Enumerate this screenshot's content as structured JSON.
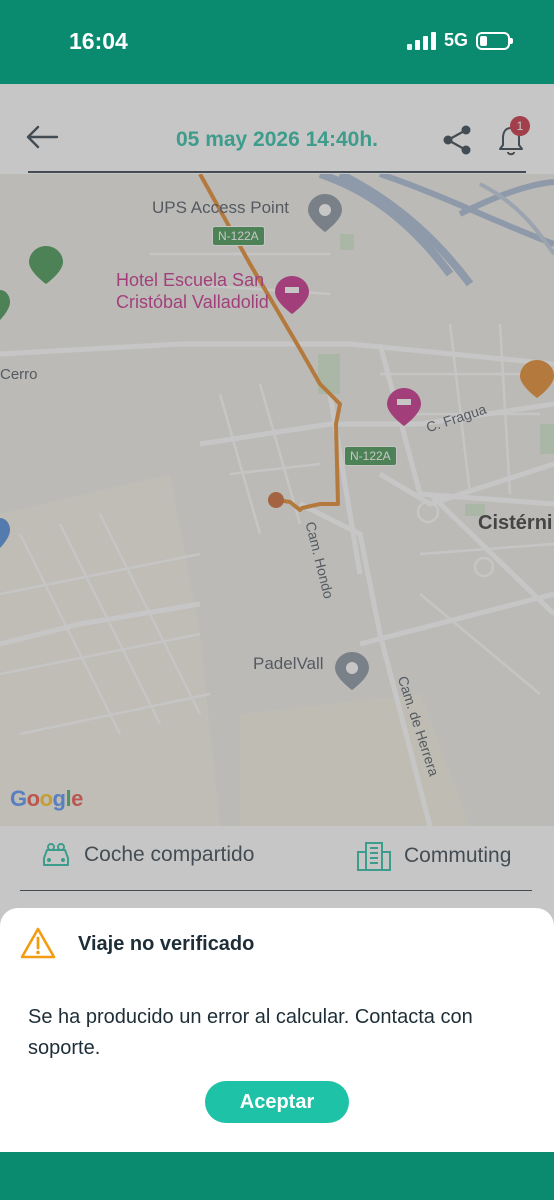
{
  "status_bar": {
    "time": "16:04",
    "network": "5G",
    "icons": [
      "signal-icon",
      "battery-icon"
    ]
  },
  "header": {
    "title": "05 may 2026 14:40h.",
    "notification_count": "1",
    "icons": [
      "back-arrow-icon",
      "share-icon",
      "bell-icon"
    ]
  },
  "map": {
    "poi_ups": "UPS Access Point",
    "poi_hotel": "Hotel Escuela San Cristóbal Valladolid",
    "poi_hotel_line1": "Hotel Escuela San",
    "poi_hotel_line2": "Cristóbal Valladolid",
    "poi_padel": "PadelVall",
    "place_cerro": "Cerro",
    "place_cisternig": "Cistérni",
    "road_fragua": "C. Fragua",
    "road_hondo": "Cam. Hondo",
    "road_herrera": "Cam. de Herrera",
    "shield_1": "N-122A",
    "shield_2": "N-122A",
    "logo": {
      "g1": "G",
      "g2": "o",
      "g3": "o",
      "g4": "g",
      "g5": "l",
      "g6": "e"
    },
    "colors": {
      "route": "#e07b12",
      "hotel": "#c2187e",
      "shield": "#2e8b3f"
    }
  },
  "info": {
    "mode_left": "Coche compartido",
    "mode_right": "Commuting"
  },
  "dialog": {
    "title": "Viaje no verificado",
    "message": "Se ha producido un error al calcular. Contacta con soporte.",
    "accept_label": "Aceptar"
  },
  "colors": {
    "brand_green": "#0a8a6e",
    "accent": "#13b79a",
    "button": "#1ec2a6",
    "badge": "#c0182a",
    "warning": "#f39c12"
  }
}
